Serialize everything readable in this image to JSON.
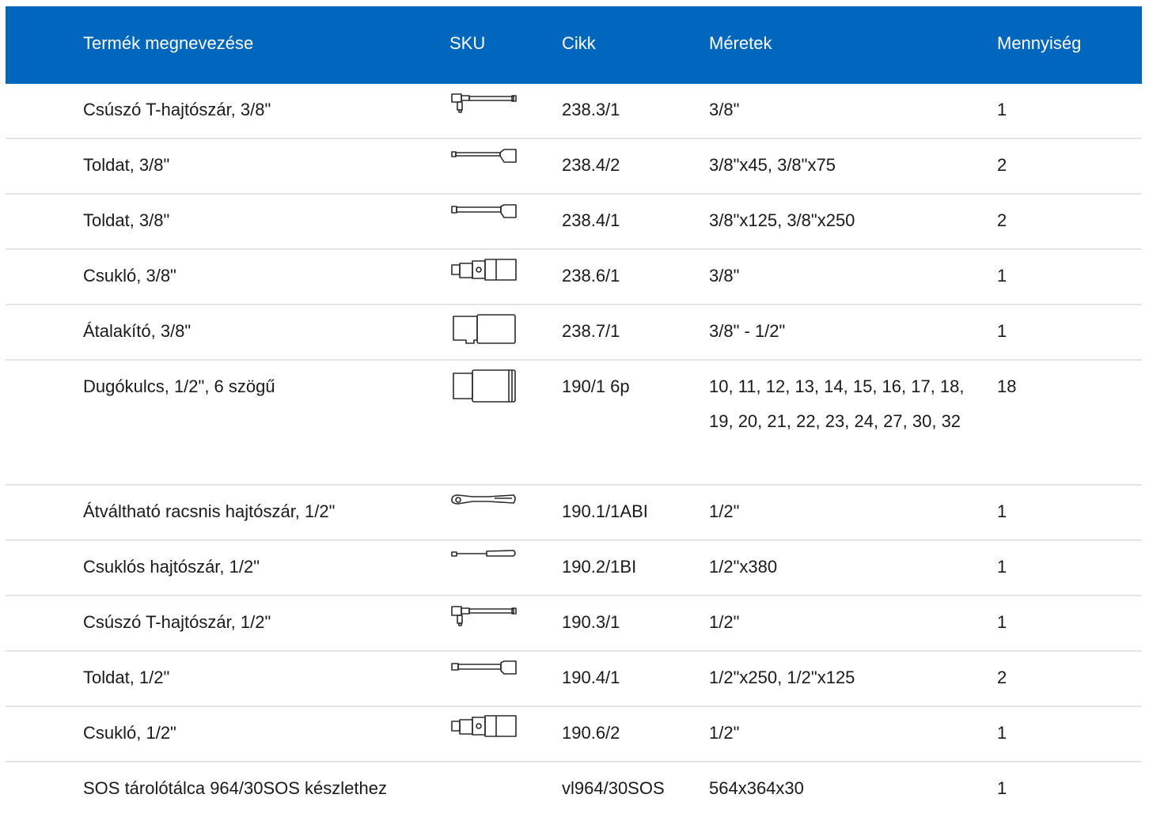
{
  "table": {
    "headers": {
      "name": "Termék megnevezése",
      "sku": "SKU",
      "article": "Cikk",
      "size": "Méretek",
      "qty": "Mennyiség"
    },
    "rows": [
      {
        "name": "Csúszó T-hajtószár, 3/8\"",
        "icon": "t-handle-icon",
        "article": "238.3/1",
        "size": "3/8\"",
        "qty": "1"
      },
      {
        "name": "Toldat, 3/8\"",
        "icon": "extension-bar-icon",
        "article": "238.4/2",
        "size": "3/8\"x45, 3/8\"x75",
        "qty": "2"
      },
      {
        "name": "Toldat, 3/8\"",
        "icon": "extension-bar-icon",
        "article": "238.4/1",
        "size": "3/8\"x125, 3/8\"x250",
        "qty": "2"
      },
      {
        "name": "Csukló, 3/8\"",
        "icon": "universal-joint-icon",
        "article": "238.6/1",
        "size": "3/8\"",
        "qty": "1"
      },
      {
        "name": "Átalakító, 3/8\"",
        "icon": "adapter-icon",
        "article": "238.7/1",
        "size": "3/8\" - 1/2\"",
        "qty": "1"
      },
      {
        "name": "Dugókulcs, 1/2\", 6 szögű",
        "icon": "socket-icon",
        "article": "190/1 6p",
        "size": "10, 11, 12, 13, 14, 15, 16, 17, 18, 19, 20, 21, 22, 23, 24, 27, 30, 32",
        "qty": "18"
      },
      {
        "name": "Átváltható racsnis hajtószár, 1/2\"",
        "icon": "ratchet-icon",
        "article": "190.1/1ABI",
        "size": "1/2\"",
        "qty": "1"
      },
      {
        "name": "Csuklós hajtószár, 1/2\"",
        "icon": "hinged-handle-icon",
        "article": "190.2/1BI",
        "size": "1/2\"x380",
        "qty": "1"
      },
      {
        "name": "Csúszó T-hajtószár, 1/2\"",
        "icon": "t-handle-icon",
        "article": "190.3/1",
        "size": "1/2\"",
        "qty": "1"
      },
      {
        "name": "Toldat, 1/2\"",
        "icon": "extension-bar-icon",
        "article": "190.4/1",
        "size": "1/2\"x250, 1/2\"x125",
        "qty": "2"
      },
      {
        "name": "Csukló, 1/2\"",
        "icon": "universal-joint-icon",
        "article": "190.6/2",
        "size": "1/2\"",
        "qty": "1"
      },
      {
        "name": "SOS tárolótálca 964/30SOS készlethez",
        "icon": "",
        "article": "vl964/30SOS",
        "size": "564x364x30",
        "qty": "1"
      }
    ]
  }
}
